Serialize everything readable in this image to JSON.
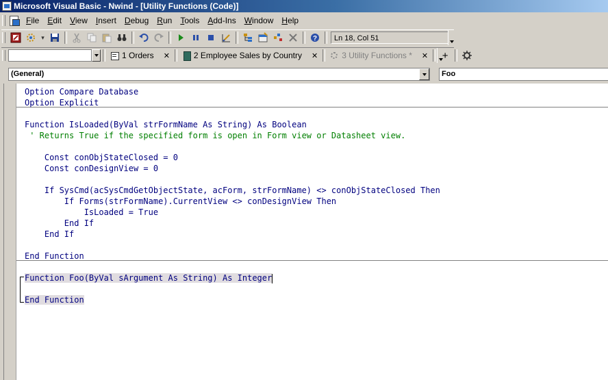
{
  "window": {
    "title": "Microsoft Visual Basic - Nwind - [Utility Functions (Code)]"
  },
  "menu": [
    "File",
    "Edit",
    "View",
    "Insert",
    "Debug",
    "Run",
    "Tools",
    "Add-Ins",
    "Window",
    "Help"
  ],
  "toolbar": {
    "position": "Ln 18, Col 51"
  },
  "tabs": [
    {
      "label": "1 Orders",
      "icon": "form-icon",
      "active": false
    },
    {
      "label": "2 Employee Sales by Country",
      "icon": "report-icon",
      "active": false
    },
    {
      "label": "3 Utility Functions *",
      "icon": "module-icon",
      "active": true
    }
  ],
  "tab_plus": "+",
  "code_window": {
    "object_combo": "(General)",
    "procedure_combo": "Foo"
  },
  "code": {
    "decl": [
      "Option Compare Database",
      "Option Explicit"
    ],
    "isloaded": {
      "l1": "Function IsLoaded(ByVal strFormName As String) As Boolean",
      "l2": " ' Returns True if the specified form is open in Form view or Datasheet view.",
      "l3": "    Const conObjStateClosed = 0",
      "l4": "    Const conDesignView = 0",
      "l5": "    If SysCmd(acSysCmdGetObjectState, acForm, strFormName) <> conObjStateClosed Then",
      "l6": "        If Forms(strFormName).CurrentView <> conDesignView Then",
      "l7": "            IsLoaded = True",
      "l8": "        End If",
      "l9": "    End If",
      "l10": "End Function"
    },
    "foo": {
      "l1": "Function Foo(ByVal sArgument As String) As Integer",
      "l2": "End Function"
    }
  }
}
